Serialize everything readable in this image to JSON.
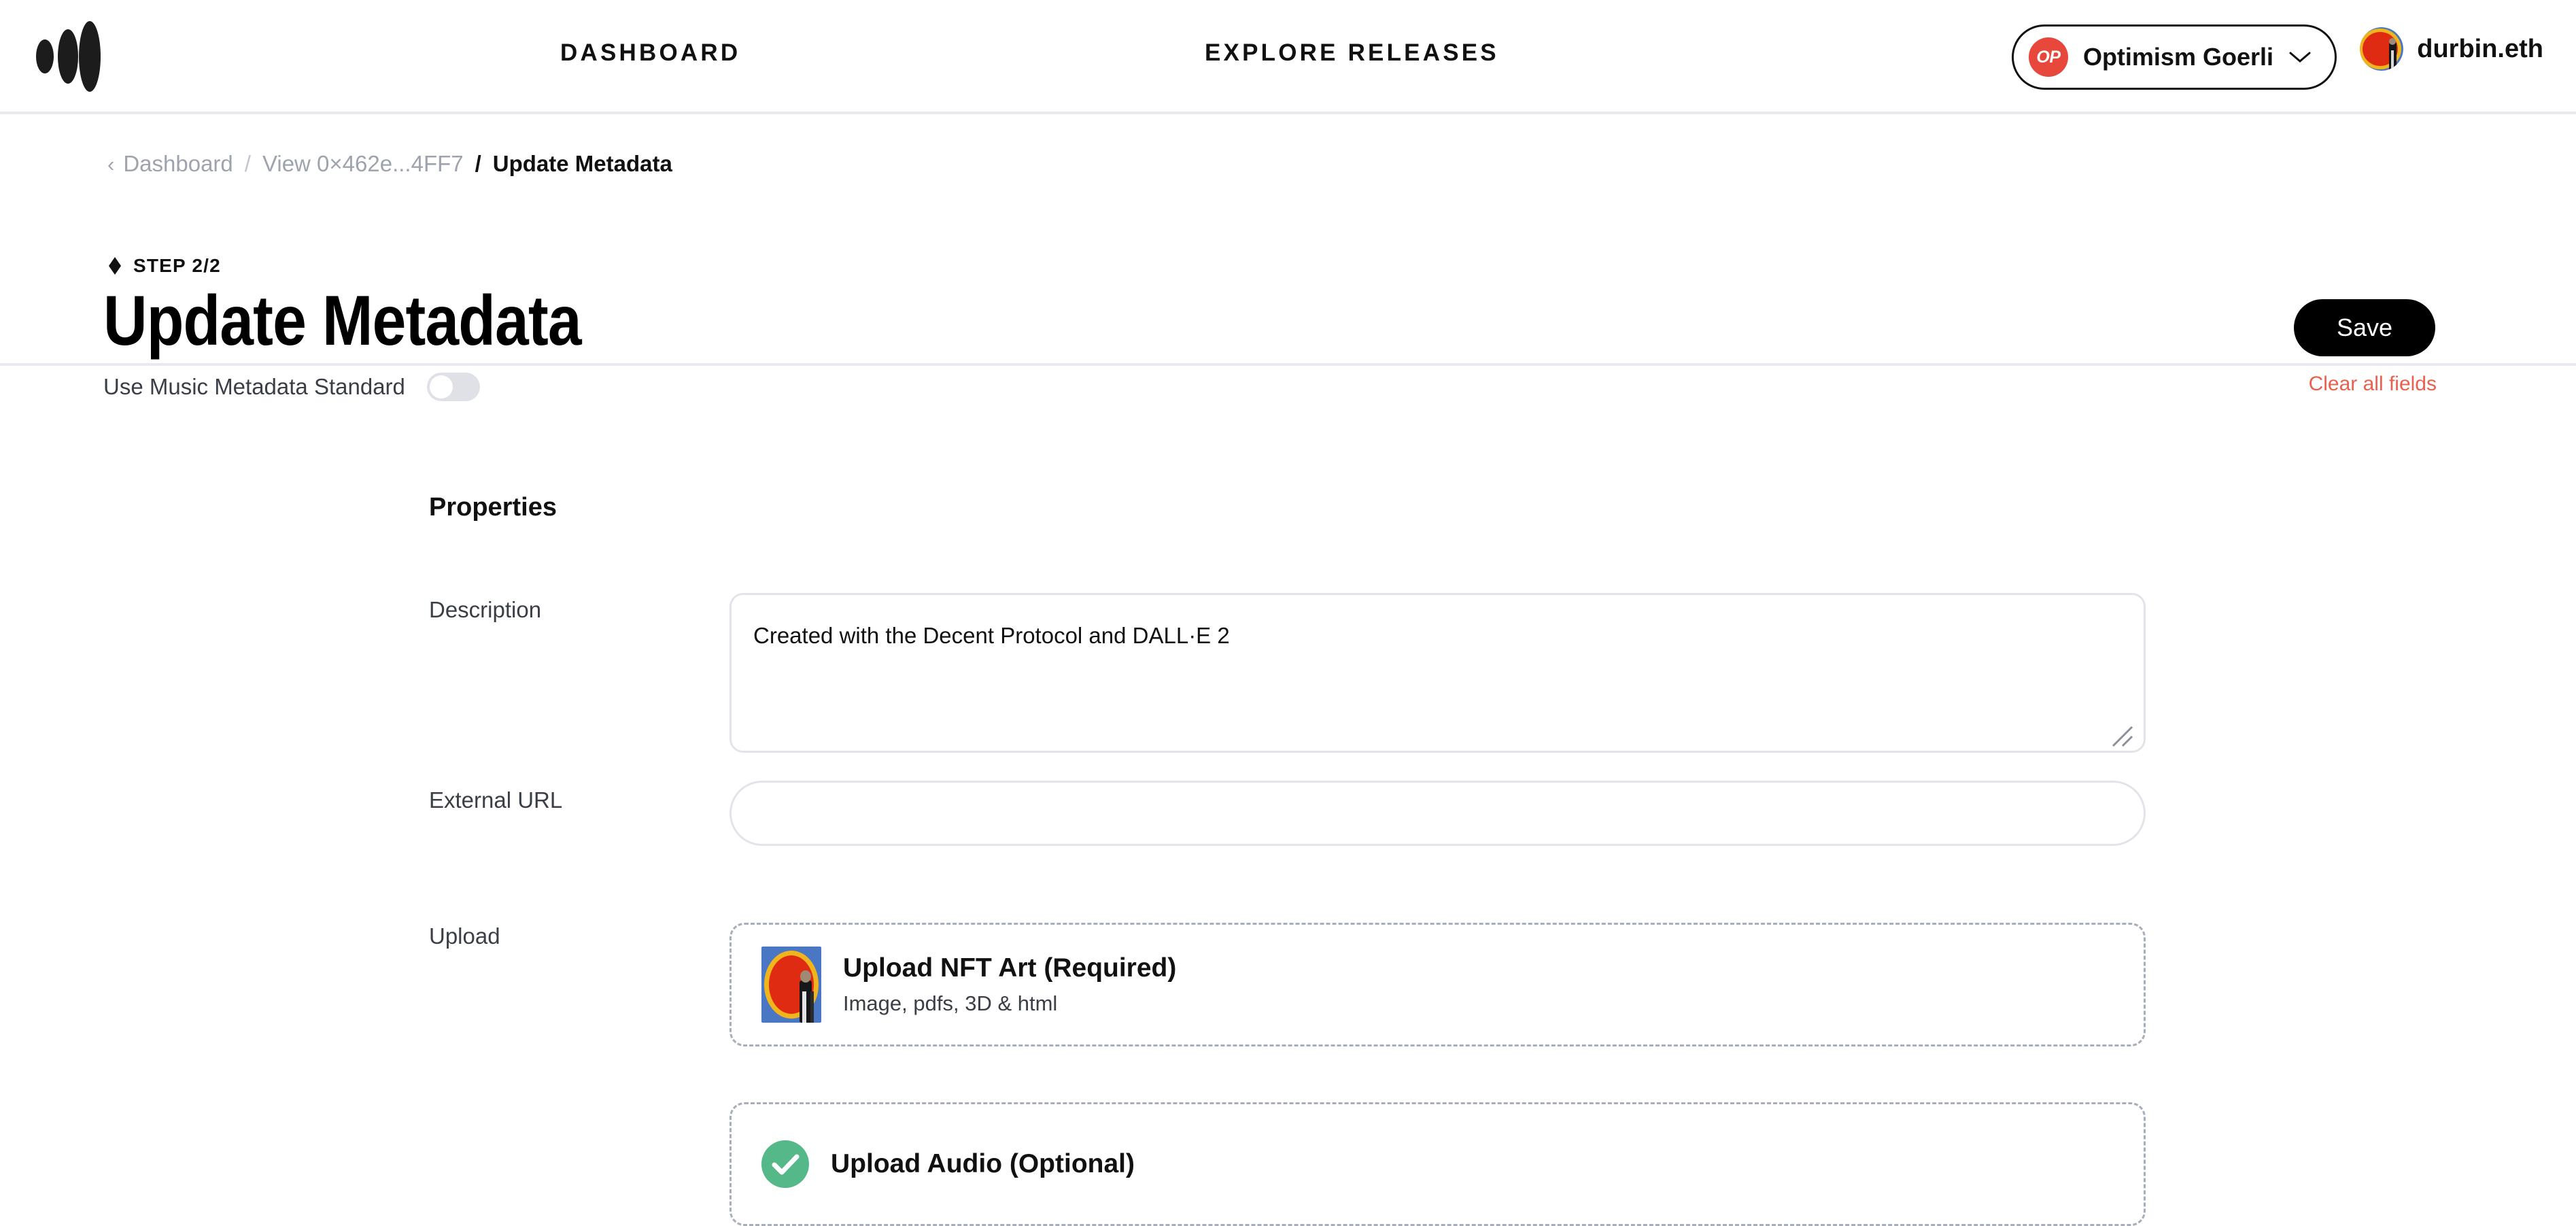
{
  "header": {
    "logo_name": "decent-logo",
    "nav": [
      {
        "label": "DASHBOARD",
        "name": "nav-dashboard"
      },
      {
        "label": "EXPLORE RELEASES",
        "name": "nav-explore-releases"
      }
    ],
    "network": {
      "badge_text": "OP",
      "name": "Optimism Goerli",
      "badge_color": "#e8473c"
    },
    "account": {
      "name": "durbin.eth"
    }
  },
  "breadcrumb": {
    "back_chevron": "‹",
    "dashboard": "Dashboard",
    "view": "View 0×462e...4FF7",
    "current": "Update Metadata",
    "separator": "/"
  },
  "page": {
    "step": "STEP 2/2",
    "title": "Update Metadata",
    "toggle_label": "Use Music Metadata Standard",
    "toggle_state": "off",
    "save_label": "Save",
    "clear_label": "Clear all fields",
    "clear_color": "#e8614f"
  },
  "form": {
    "section_title": "Properties",
    "description": {
      "label": "Description",
      "value": "Created with the Decent Protocol and DALL·E 2",
      "placeholder": ""
    },
    "external_url": {
      "label": "External URL",
      "value": "",
      "placeholder": ""
    },
    "upload": {
      "label": "Upload",
      "cards": [
        {
          "title": "Upload NFT Art (Required)",
          "subtitle": "Image, pdfs, 3D & html",
          "icon": "nft-art-thumbnail"
        },
        {
          "title": "Upload Audio (Optional)",
          "subtitle": "",
          "icon": "green-check-icon"
        }
      ]
    }
  }
}
